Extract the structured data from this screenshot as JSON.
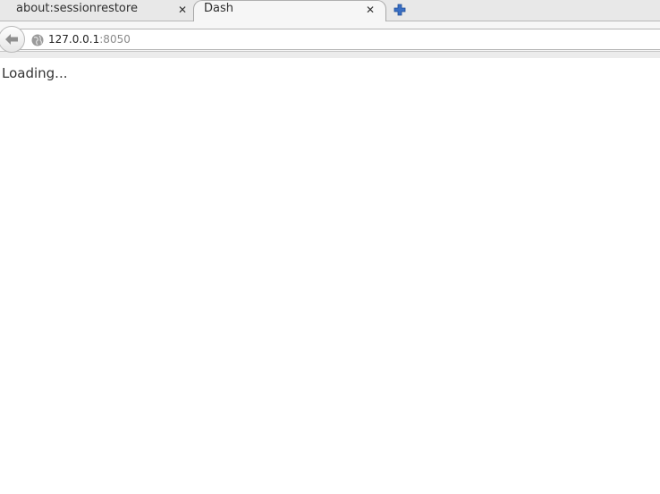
{
  "tabs": [
    {
      "label": "about:sessionrestore",
      "close": "✕",
      "active": false
    },
    {
      "label": "Dash",
      "close": "✕",
      "active": true
    }
  ],
  "new_tab_icon": "plus-icon",
  "navbar": {
    "back_icon": "back-arrow-icon",
    "site_icon": "globe-icon",
    "url_host": "127.0.0.1",
    "url_port": ":8050"
  },
  "page": {
    "loading_text": "Loading..."
  },
  "colors": {
    "new_tab_blue": "#3a6fc4",
    "port_gray": "#8a8a8a"
  }
}
